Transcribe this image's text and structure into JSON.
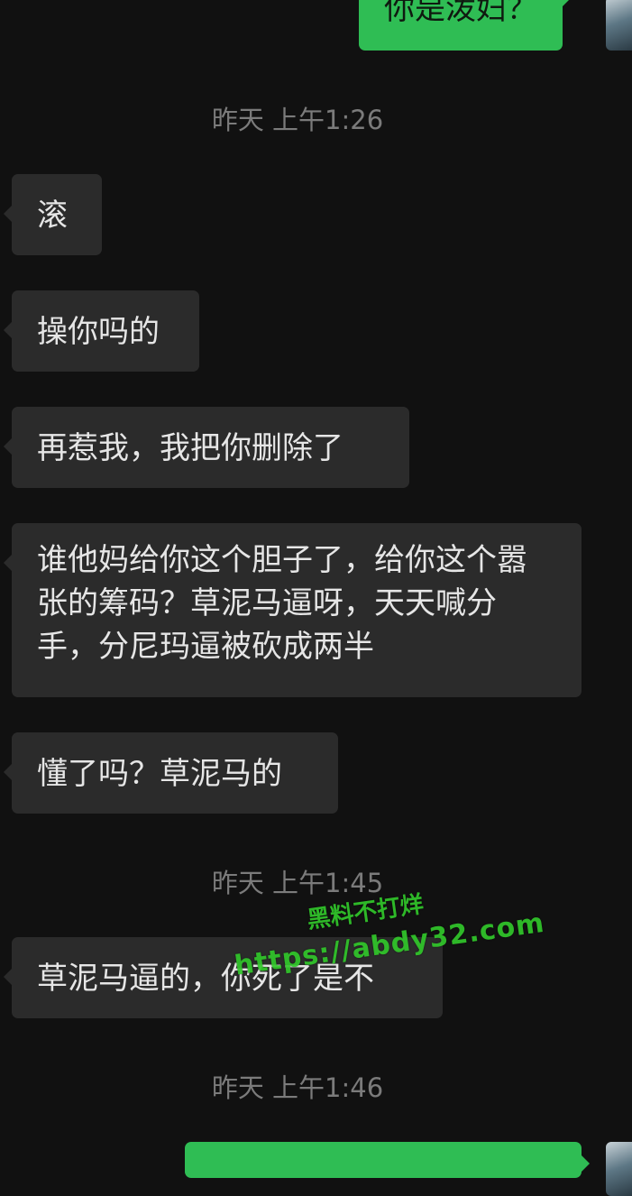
{
  "messages": {
    "top_sent": "你是泼妇？",
    "ts1": "昨天 上午1:26",
    "m1": "滚",
    "m2": "操你吗的",
    "m3": "再惹我，我把你删除了",
    "m4": "谁他妈给你这个胆子了，给你这个嚣张的筹码？草泥马逼呀，天天喊分手，分尼玛逼被砍成两半",
    "m5": "懂了吗？草泥马的",
    "ts2": "昨天 上午1:45",
    "m6": "草泥马逼的，你死了是不",
    "ts3": "昨天 上午1:46"
  },
  "watermark": {
    "line1": "黑料不打烊",
    "line2": "https://abdy32.com"
  },
  "colors": {
    "background": "#111111",
    "incoming_bubble": "#2b2b2b",
    "outgoing_bubble": "#2fbd54",
    "timestamp": "#7b7b7b",
    "watermark": "#31c72a"
  }
}
